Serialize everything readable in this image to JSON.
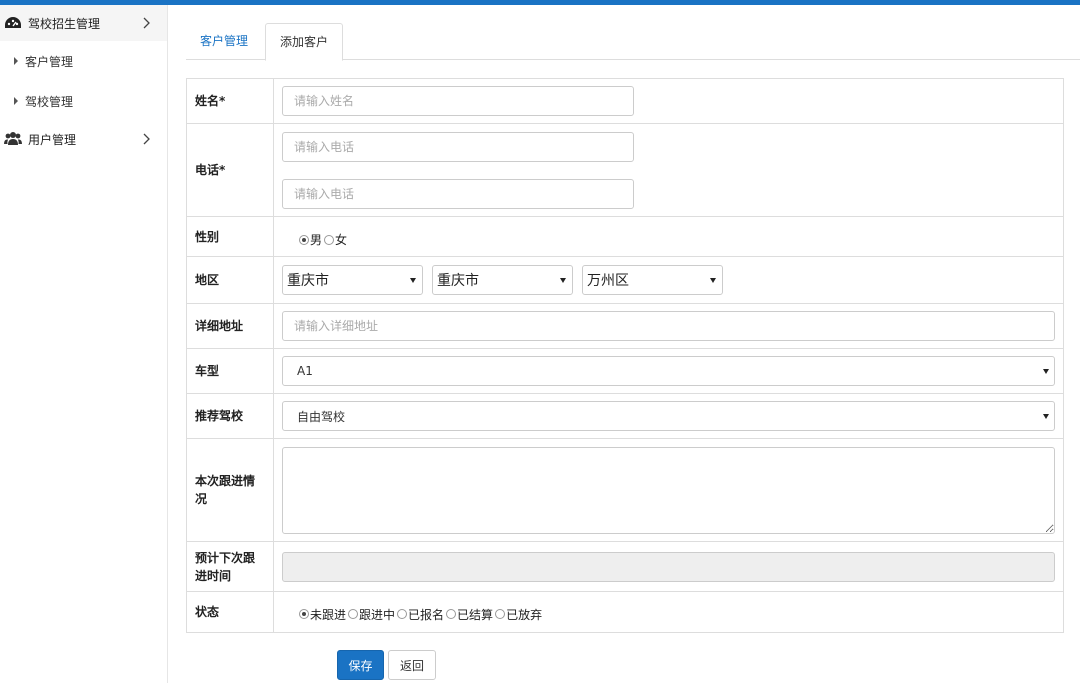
{
  "sidebar": {
    "groups": [
      {
        "label": "驾校招生管理",
        "icon": "dashboard-icon",
        "items": [
          "客户管理",
          "驾校管理"
        ]
      },
      {
        "label": "用户管理",
        "icon": "users-icon",
        "items": []
      }
    ]
  },
  "tabs": [
    {
      "label": "客户管理",
      "active": false
    },
    {
      "label": "添加客户",
      "active": true
    }
  ],
  "form": {
    "name": {
      "label": "姓名*",
      "placeholder": "请输入姓名"
    },
    "phone": {
      "label": "电话*",
      "placeholder1": "请输入电话",
      "placeholder2": "请输入电话"
    },
    "gender": {
      "label": "性别",
      "options": [
        "男",
        "女"
      ],
      "selected": "男"
    },
    "region": {
      "label": "地区",
      "province": "重庆市",
      "city": "重庆市",
      "district": "万州区"
    },
    "address": {
      "label": "详细地址",
      "placeholder": "请输入详细地址"
    },
    "car_type": {
      "label": "车型",
      "value": "A1"
    },
    "school": {
      "label": "推荐驾校",
      "value": "自由驾校"
    },
    "followup": {
      "label": "本次跟进情况",
      "value": ""
    },
    "next_time": {
      "label": "预计下次跟进时间",
      "value": ""
    },
    "status": {
      "label": "状态",
      "options": [
        "未跟进",
        "跟进中",
        "已报名",
        "已结算",
        "已放弃"
      ],
      "selected": "未跟进"
    }
  },
  "buttons": {
    "save": "保存",
    "back": "返回"
  },
  "colors": {
    "accent": "#1a73c4"
  }
}
